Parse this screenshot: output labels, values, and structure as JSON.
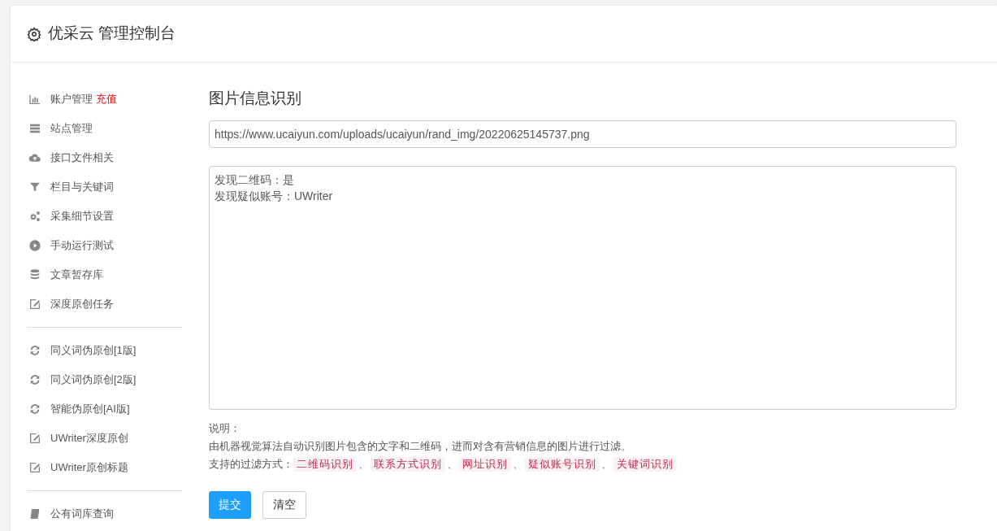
{
  "header": {
    "title": "优采云 管理控制台"
  },
  "sidebar": {
    "groups": [
      {
        "items": [
          {
            "label": "账户管理",
            "badge": "充值"
          },
          {
            "label": "站点管理"
          },
          {
            "label": "接口文件相关"
          },
          {
            "label": "栏目与关键词"
          },
          {
            "label": "采集细节设置"
          },
          {
            "label": "手动运行测试"
          },
          {
            "label": "文章暂存库"
          },
          {
            "label": "深度原创任务"
          }
        ]
      },
      {
        "items": [
          {
            "label": "同义词伪原创[1版]"
          },
          {
            "label": "同义词伪原创[2版]"
          },
          {
            "label": "智能伪原创[AI版]"
          },
          {
            "label": "UWriter深度原创"
          },
          {
            "label": "UWriter原创标题"
          }
        ]
      },
      {
        "items": [
          {
            "label": "公有词库查询"
          }
        ]
      }
    ]
  },
  "main": {
    "title": "图片信息识别",
    "url_field": {
      "value": "https://www.ucaiyun.com/uploads/ucaiyun/rand_img/20220625145737.png"
    },
    "result_box": {
      "lines": [
        "发现二维码：是",
        "发现疑似账号：UWriter"
      ]
    },
    "notes": {
      "heading": "说明：",
      "description": "由机器视觉算法自动识别图片包含的文字和二维码，进而对含有营销信息的图片进行过滤。",
      "filters_label": "支持的过滤方式：",
      "separator": "、",
      "filters": [
        "二维码识别",
        "联系方式识别",
        "网址识别",
        "疑似账号识别",
        "关键词识别"
      ]
    },
    "buttons": [
      {
        "label": "提交",
        "kind": "primary"
      },
      {
        "label": "清空",
        "kind": "default"
      }
    ]
  }
}
